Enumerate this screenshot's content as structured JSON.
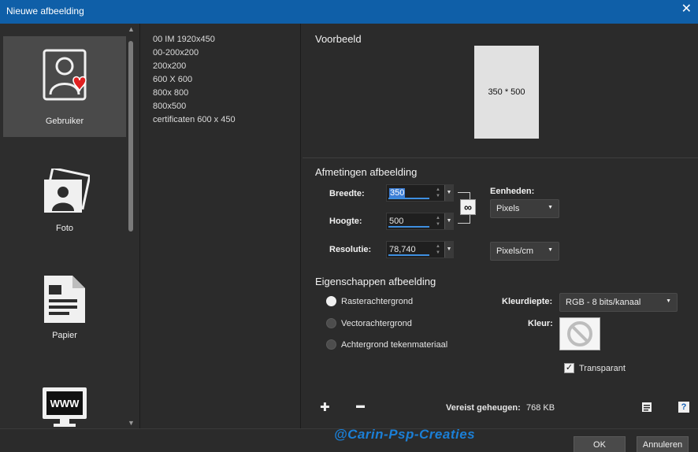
{
  "window": {
    "title": "Nieuwe afbeelding",
    "close_glyph": "✕"
  },
  "categories": [
    {
      "label": "Gebruiker",
      "icon": "user-icon",
      "selected": true
    },
    {
      "label": "Foto",
      "icon": "photo-icon",
      "selected": false
    },
    {
      "label": "Papier",
      "icon": "paper-icon",
      "selected": false
    },
    {
      "label": "",
      "icon": "www-monitor-icon",
      "selected": false
    }
  ],
  "presets": [
    "00 IM 1920x450",
    "00-200x200",
    "200x200",
    "600 X 600",
    "800x 800",
    "800x500",
    "certificaten 600 x 450"
  ],
  "preview": {
    "heading": "Voorbeeld",
    "size_label": "350 * 500"
  },
  "dimensions": {
    "heading": "Afmetingen afbeelding",
    "width_label": "Breedte:",
    "width_value": "350",
    "height_label": "Hoogte:",
    "height_value": "500",
    "resolution_label": "Resolutie:",
    "resolution_value": "78,740",
    "units_label": "Eenheden:",
    "units_value": "Pixels",
    "res_units_value": "Pixels/cm",
    "chain_glyph": "∞"
  },
  "properties": {
    "heading": "Eigenschappen afbeelding",
    "raster_label": "Rasterachtergrond",
    "vector_label": "Vectorachtergrond",
    "art_label": "Achtergrond tekenmateriaal",
    "selected": "raster",
    "depth_label": "Kleurdiepte:",
    "depth_value": "RGB - 8 bits/kanaal",
    "color_label": "Kleur:",
    "transparent_label": "Transparant",
    "transparent_checked": true
  },
  "bottom": {
    "add_glyph": "✚",
    "remove_glyph": "▬",
    "memory_label": "Vereist geheugen:",
    "memory_value": "768 KB",
    "help_glyph": "?"
  },
  "buttons": {
    "ok": "OK",
    "cancel": "Annuleren"
  },
  "watermark": "@Carin-Psp-Creaties",
  "colors": {
    "titlebar": "#0f5fa8",
    "selection": "#3d7fd6",
    "heart": "#e02020",
    "watermark": "#1b7fd6"
  }
}
